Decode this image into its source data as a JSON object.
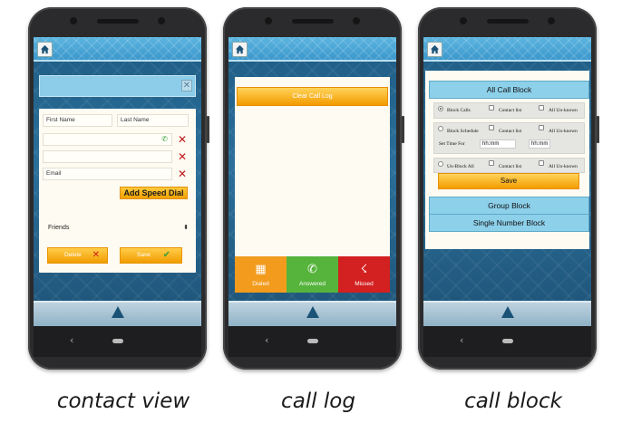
{
  "captions": [
    "contact view",
    "call log",
    "call block"
  ],
  "contact_view": {
    "first_name_placeholder": "First Name",
    "last_name_placeholder": "Last Name",
    "close_glyph": "✕",
    "email_label": "Email",
    "add_speed_dial": "Add Speed Dial",
    "group_select": "Friends",
    "delete_label": "Delete",
    "save_label": "Save"
  },
  "call_log": {
    "clear_label": "Clear Call Log",
    "tabs": [
      {
        "label": "Dialed",
        "icon": "dialpad-icon",
        "color": "#f29b1c"
      },
      {
        "label": "Answered",
        "icon": "phone-icon",
        "color": "#56b43c"
      },
      {
        "label": "Missed",
        "icon": "missed-call-icon",
        "color": "#d32020"
      }
    ]
  },
  "call_block": {
    "all_call_block": "All Call Block",
    "row1": {
      "block_calls": "Block Calls",
      "contact_list": "Contact list",
      "all_unknown": "All Un-known"
    },
    "row2": {
      "block_schedule": "Block Schedule",
      "contact_list": "Contact list",
      "all_unknown": "All Un-known",
      "set_time_for": "Set Time For",
      "time_from": "hh:mm",
      "time_to": "hh:mm"
    },
    "row3": {
      "unblock_all": "Un-Block All",
      "contact_list": "Contact list",
      "all_unknown": "All Un-known"
    },
    "save_label": "Save",
    "group_block": "Group Block",
    "single_number_block": "Single Number Block"
  },
  "nav": {
    "back_glyph": "‹"
  },
  "colors": {
    "accent": "#f2a100",
    "topbar": "#4aa8d8",
    "screen_bg": "#2a6f9a"
  }
}
